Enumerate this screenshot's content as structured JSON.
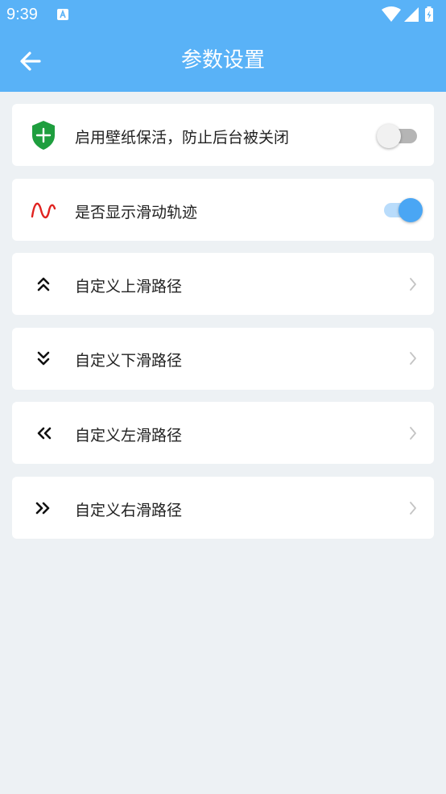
{
  "status_bar": {
    "time": "9:39",
    "notification_icon": "text-a-icon",
    "system_icons": [
      "wifi-icon",
      "signal-icon",
      "battery-charging-icon"
    ]
  },
  "app_bar": {
    "title": "参数设置",
    "back_icon": "arrow-left-icon"
  },
  "settings": [
    {
      "label": "启用壁纸保活，防止后台被关闭",
      "icon": "shield-plus-icon",
      "control": "toggle",
      "enabled": false
    },
    {
      "label": "是否显示滑动轨迹",
      "icon": "wave-icon",
      "control": "toggle",
      "enabled": true
    },
    {
      "label": "自定义上滑路径",
      "icon": "double-chevron-up-icon",
      "control": "chevron"
    },
    {
      "label": "自定义下滑路径",
      "icon": "double-chevron-down-icon",
      "control": "chevron"
    },
    {
      "label": "自定义左滑路径",
      "icon": "double-chevron-left-icon",
      "control": "chevron"
    },
    {
      "label": "自定义右滑路径",
      "icon": "double-chevron-right-icon",
      "control": "chevron"
    }
  ],
  "colors": {
    "primary": "#59b2f7",
    "background": "#edf1f4",
    "card": "#ffffff",
    "shield_green": "#1e9e3e",
    "wave_red": "#e0221f",
    "toggle_on": "#4aa6f4",
    "toggle_off_track": "#b5b5b5"
  }
}
